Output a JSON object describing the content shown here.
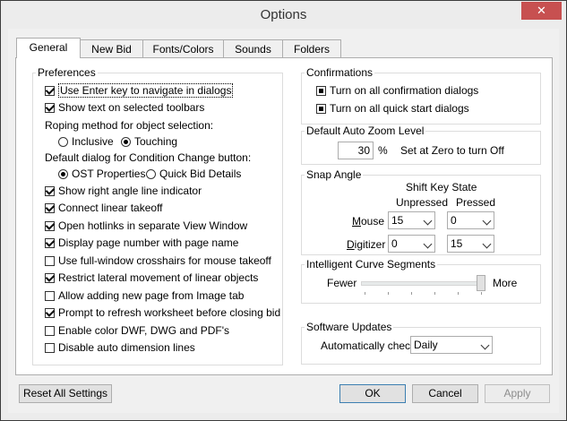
{
  "window": {
    "title": "Options",
    "close_symbol": "✕"
  },
  "tabs": [
    {
      "label": "General",
      "active": true
    },
    {
      "label": "New Bid"
    },
    {
      "label": "Fonts/Colors"
    },
    {
      "label": "Sounds"
    },
    {
      "label": "Folders"
    }
  ],
  "preferences": {
    "title": "Preferences",
    "items": [
      {
        "label": "Use Enter key to navigate in dialogs",
        "checked": true
      },
      {
        "label": "Show text on selected toolbars",
        "checked": true
      }
    ],
    "roping_label": "Roping method for object selection:",
    "roping_options": [
      {
        "label": "Inclusive",
        "selected": false
      },
      {
        "label": "Touching",
        "selected": true
      }
    ],
    "default_dialog_label": "Default dialog for Condition Change button:",
    "default_dialog_options": [
      {
        "label": "OST Properties",
        "selected": true
      },
      {
        "label": "Quick Bid Details",
        "selected": false
      }
    ],
    "more_items": [
      {
        "label": "Show right angle line indicator",
        "checked": true
      },
      {
        "label": "Connect linear takeoff",
        "checked": true
      },
      {
        "label": "Open hotlinks in separate View Window",
        "checked": true
      },
      {
        "label": "Display page number with page name",
        "checked": true
      },
      {
        "label": "Use full-window crosshairs for mouse takeoff",
        "checked": false
      },
      {
        "label": "Restrict lateral movement of linear objects",
        "checked": true
      },
      {
        "label": "Allow adding new page from Image tab",
        "checked": false
      },
      {
        "label": "Prompt to refresh worksheet before closing bid",
        "checked": true
      },
      {
        "label": "Enable color DWF, DWG and PDF's",
        "checked": false
      },
      {
        "label": "Disable auto dimension lines",
        "checked": false
      }
    ]
  },
  "confirmations": {
    "title": "Confirmations",
    "items": [
      {
        "label": "Turn on all confirmation dialogs",
        "checked": true
      },
      {
        "label": "Turn on all quick start dialogs",
        "checked": true
      }
    ]
  },
  "zoom": {
    "title": "Default Auto Zoom Level",
    "value": "30",
    "unit": "%",
    "hint": "Set at Zero to turn Off"
  },
  "snap": {
    "title": "Snap Angle",
    "shift_header": "Shift Key State",
    "col_unpressed": "Unpressed",
    "col_pressed": "Pressed",
    "mouse_label_u": "M",
    "mouse_label_rest": "ouse",
    "digitizer_label_u": "D",
    "digitizer_label_rest": "igitizer",
    "mouse_unpressed": "15",
    "mouse_pressed": "0",
    "digitizer_unpressed": "0",
    "digitizer_pressed": "15"
  },
  "curve": {
    "title": "Intelligent Curve Segments",
    "left_label": "Fewer",
    "right_label": "More",
    "level": 1.0
  },
  "updates": {
    "title": "Software Updates",
    "label": "Automatically check",
    "value": "Daily"
  },
  "buttons": {
    "reset": "Reset All Settings",
    "ok": "OK",
    "cancel": "Cancel",
    "apply": "Apply"
  }
}
